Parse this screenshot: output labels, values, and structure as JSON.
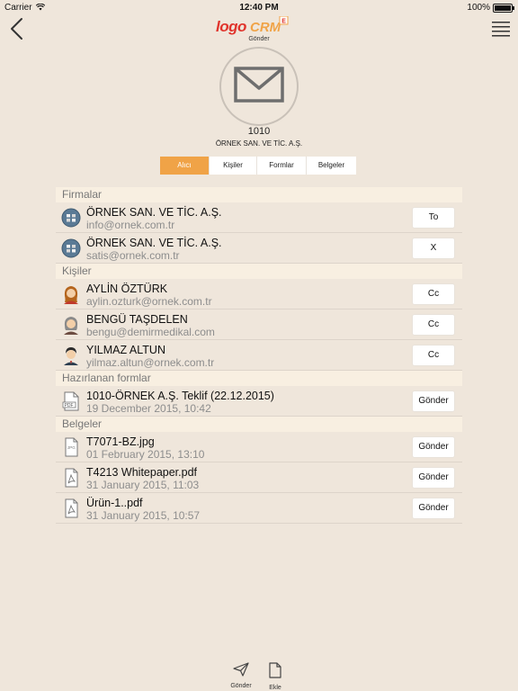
{
  "status_bar": {
    "carrier": "Carrier",
    "time": "12:40 PM",
    "battery": "100%"
  },
  "nav": {
    "logo_text": "LOGO CRM",
    "logo_badge": "E",
    "subtitle": "Gönder"
  },
  "header": {
    "code": "1010",
    "company": "ÖRNEK SAN. VE TİC. A.Ş."
  },
  "tabs": [
    {
      "label": "Alıcı",
      "active": true
    },
    {
      "label": "Kişiler",
      "active": false
    },
    {
      "label": "Formlar",
      "active": false
    },
    {
      "label": "Belgeler",
      "active": false
    }
  ],
  "sections": {
    "firmalar": {
      "title": "Firmalar",
      "rows": [
        {
          "title": "ÖRNEK SAN. VE TİC. A.Ş.",
          "sub": "info@ornek.com.tr",
          "button": "To",
          "icon": "company-globe-icon"
        },
        {
          "title": "ÖRNEK SAN. VE TİC. A.Ş.",
          "sub": "satis@ornek.com.tr",
          "button": "X",
          "icon": "company-globe-icon"
        }
      ]
    },
    "kisiler": {
      "title": "Kişiler",
      "rows": [
        {
          "title": "AYLİN ÖZTÜRK",
          "sub": "aylin.ozturk@ornek.com.tr",
          "button": "Cc",
          "icon": "female-avatar-icon"
        },
        {
          "title": "BENGÜ TAŞDELEN",
          "sub": "bengu@demirmedikal.com",
          "button": "Cc",
          "icon": "female-avatar-gray-icon"
        },
        {
          "title": "YILMAZ ALTUN",
          "sub": "yilmaz.altun@ornek.com.tr",
          "button": "Cc",
          "icon": "male-avatar-icon"
        }
      ]
    },
    "formlar": {
      "title": "Hazırlanan formlar",
      "rows": [
        {
          "title": "1010-ÖRNEK A.Ş. Teklif (22.12.2015)",
          "sub": "19 December 2015, 10:42",
          "button": "Gönder",
          "icon": "pdf-file-icon"
        }
      ]
    },
    "belgeler": {
      "title": "Belgeler",
      "rows": [
        {
          "title": "T7071-BZ.jpg",
          "sub": "01 February 2015, 13:10",
          "button": "Gönder",
          "icon": "jpg-file-icon"
        },
        {
          "title": "T4213 Whitepaper.pdf",
          "sub": "31 January 2015, 11:03",
          "button": "Gönder",
          "icon": "pdf-file-icon"
        },
        {
          "title": "Ürün-1..pdf",
          "sub": "31 January 2015, 10:57",
          "button": "Gönder",
          "icon": "pdf-file-icon"
        }
      ]
    }
  },
  "toolbar": {
    "send_label": "Gönder",
    "attach_label": "Ekle"
  },
  "colors": {
    "background": "#efe6db",
    "accent": "#f0a347",
    "section_bg": "#f8efe1",
    "logo_red": "#e0342c"
  }
}
